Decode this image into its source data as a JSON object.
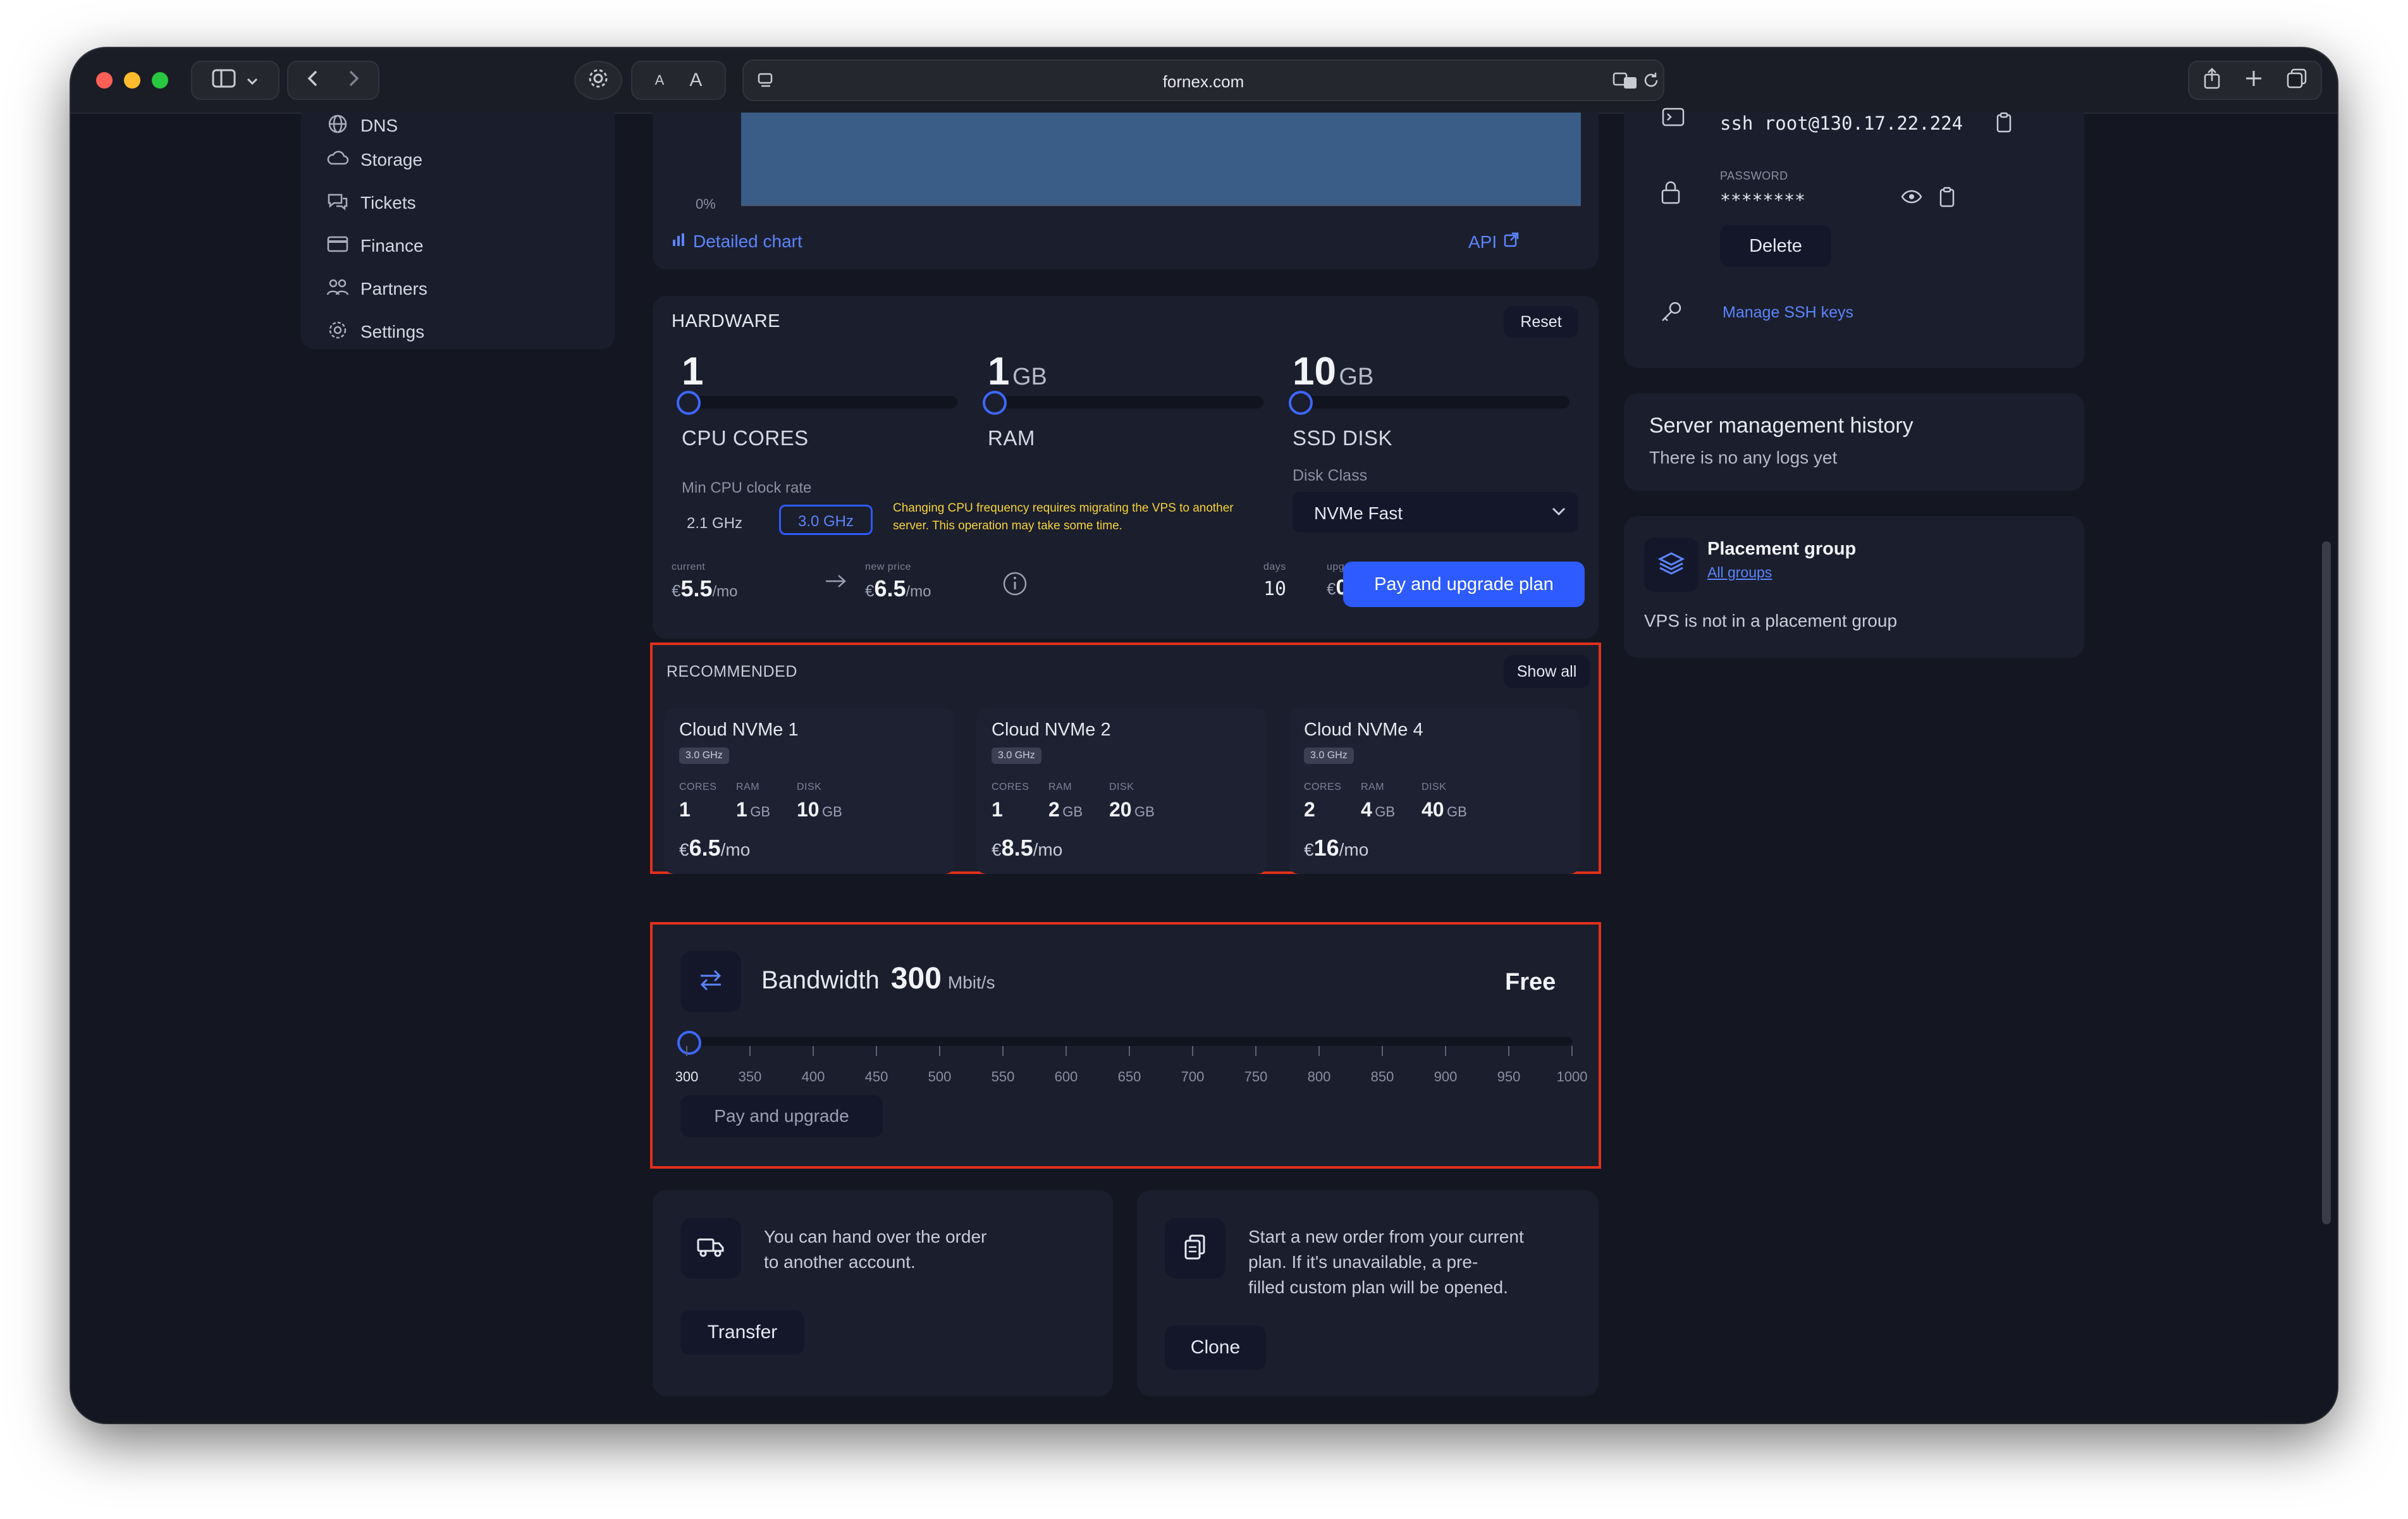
{
  "browser": {
    "url": "fornex.com",
    "reader_small": "A",
    "reader_large": "A"
  },
  "sidebar": {
    "items": [
      {
        "label": "DNS",
        "icon": "globe-icon"
      },
      {
        "label": "Storage",
        "icon": "cloud-icon"
      },
      {
        "label": "Tickets",
        "icon": "chat-icon"
      },
      {
        "label": "Finance",
        "icon": "card-icon"
      },
      {
        "label": "Partners",
        "icon": "users-icon"
      },
      {
        "label": "Settings",
        "icon": "gear-icon"
      }
    ]
  },
  "traffic_chart": {
    "y_tick": "0%",
    "detailed_link": "Detailed chart",
    "api_link": "API",
    "chart_data": {
      "type": "area",
      "yticks": [
        "0%"
      ]
    }
  },
  "hardware": {
    "title": "HARDWARE",
    "reset": "Reset",
    "cpu": {
      "value": "1",
      "label": "CPU CORES"
    },
    "ram": {
      "value": "1",
      "unit": "GB",
      "label": "RAM"
    },
    "disk": {
      "value": "10",
      "unit": "GB",
      "label": "SSD DISK"
    },
    "min_cpu_label": "Min CPU clock rate",
    "clock_options": [
      "2.1 GHz",
      "3.0 GHz"
    ],
    "selected_clock": "3.0 GHz",
    "cpu_warning": "Changing CPU frequency requires migrating the VPS to another server. This operation may take some time.",
    "disk_class_label": "Disk Class",
    "disk_class_value": "NVMe Fast",
    "current_label": "current",
    "current_currency": "€",
    "current_price": "5.5",
    "current_period": "/mo",
    "new_price_label": "new price",
    "new_currency": "€",
    "new_price": "6.5",
    "new_period": "/mo",
    "days_label": "days",
    "days_value": "10",
    "upgrade_cost_label": "upgrade cost",
    "upgrade_currency": "€",
    "upgrade_cost": "0.32",
    "pay_button": "Pay and upgrade plan"
  },
  "recommended": {
    "title": "RECOMMENDED",
    "show_all": "Show all",
    "plans": [
      {
        "name": "Cloud NVMe 1",
        "ghz": "3.0 GHz",
        "cores_label": "CORES",
        "ram_label": "RAM",
        "disk_label": "DISK",
        "cores": "1",
        "ram": "1",
        "ram_unit": "GB",
        "disk": "10",
        "disk_unit": "GB",
        "currency": "€",
        "price": "6.5",
        "period": "/mo"
      },
      {
        "name": "Cloud NVMe 2",
        "ghz": "3.0 GHz",
        "cores_label": "CORES",
        "ram_label": "RAM",
        "disk_label": "DISK",
        "cores": "1",
        "ram": "2",
        "ram_unit": "GB",
        "disk": "20",
        "disk_unit": "GB",
        "currency": "€",
        "price": "8.5",
        "period": "/mo"
      },
      {
        "name": "Cloud NVMe 4",
        "ghz": "3.0 GHz",
        "cores_label": "CORES",
        "ram_label": "RAM",
        "disk_label": "DISK",
        "cores": "2",
        "ram": "4",
        "ram_unit": "GB",
        "disk": "40",
        "disk_unit": "GB",
        "currency": "€",
        "price": "16",
        "period": "/mo"
      }
    ]
  },
  "bandwidth": {
    "label": "Bandwidth",
    "value": "300",
    "unit": "Mbit/s",
    "price": "Free",
    "ticks": [
      "300",
      "350",
      "400",
      "450",
      "500",
      "550",
      "600",
      "650",
      "700",
      "750",
      "800",
      "850",
      "900",
      "950",
      "1000"
    ],
    "selected": 300,
    "pay_button": "Pay and upgrade"
  },
  "transfer": {
    "text_line1": "You can hand over the order",
    "text_line2": "to another account.",
    "button": "Transfer"
  },
  "clone": {
    "text_line1": "Start a new order from your current",
    "text_line2": "plan. If it's unavailable, a pre-",
    "text_line3": "filled custom plan will be opened.",
    "button": "Clone"
  },
  "access": {
    "ssh_command": "ssh root@130.17.22.224",
    "password_label": "PASSWORD",
    "password_masked": "********",
    "delete_button": "Delete",
    "manage_keys": "Manage SSH keys"
  },
  "history": {
    "title": "Server management history",
    "empty": "There is no any logs yet"
  },
  "placement": {
    "title": "Placement group",
    "link": "All groups",
    "status": "VPS is not in a placement group"
  },
  "colors": {
    "accent": "#2d5bff",
    "panel": "#1b1e2c",
    "background": "#141622",
    "highlight_border": "#e2301c",
    "warning_text": "#f5d33a"
  }
}
